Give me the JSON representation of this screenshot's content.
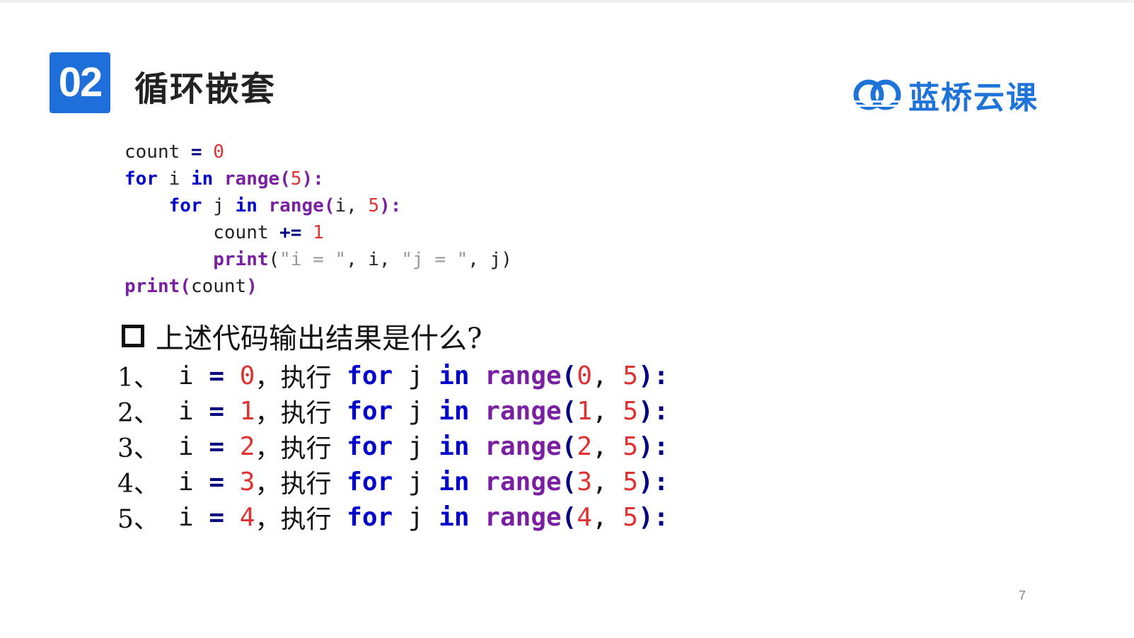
{
  "header": {
    "badge": "02",
    "title": "循环嵌套",
    "logo_text": "蓝桥云课",
    "brand_color": "#1e6fd9"
  },
  "code": {
    "line1": {
      "a": "count ",
      "op": "=",
      "num": "0"
    },
    "line2": {
      "kw1": "for",
      "a": " i ",
      "kw2": "in",
      "fn": "range",
      "p1": "(",
      "num": "5",
      "p2": "):"
    },
    "line3": {
      "indent": "    ",
      "kw1": "for",
      "a": " j ",
      "kw2": "in",
      "fn": "range",
      "p1": "(",
      "b": "i, ",
      "num": "5",
      "p2": "):"
    },
    "line4": {
      "indent": "        ",
      "a": "count ",
      "op": "+=",
      "num": "1"
    },
    "line5": {
      "indent": "        ",
      "fn": "print",
      "p1": "(",
      "s1": "\"i = \"",
      "b": ", i, ",
      "s2": "\"j = \"",
      "c": ", j)"
    },
    "line6": {
      "fn": "print",
      "p1": "(",
      "a": "count",
      "p2": ")"
    }
  },
  "question": "上述代码输出结果是什么?",
  "steps": [
    {
      "idx": "1、",
      "i": "i",
      "eq": "=",
      "val": "0",
      "sep": "，",
      "zh": "执行",
      "kw1": "for",
      "j": "j",
      "kw2": "in",
      "fn": "range",
      "open": "(",
      "start": "0",
      "comma": ",",
      "end": "5",
      "close": "):"
    },
    {
      "idx": "2、",
      "i": "i",
      "eq": "=",
      "val": "1",
      "sep": "，",
      "zh": "执行",
      "kw1": "for",
      "j": "j",
      "kw2": "in",
      "fn": "range",
      "open": "(",
      "start": "1",
      "comma": ",",
      "end": "5",
      "close": "):"
    },
    {
      "idx": "3、",
      "i": "i",
      "eq": "=",
      "val": "2",
      "sep": "，",
      "zh": "执行",
      "kw1": "for",
      "j": "j",
      "kw2": "in",
      "fn": "range",
      "open": "(",
      "start": "2",
      "comma": ",",
      "end": "5",
      "close": "):"
    },
    {
      "idx": "4、",
      "i": "i",
      "eq": "=",
      "val": "3",
      "sep": "，",
      "zh": "执行",
      "kw1": "for",
      "j": "j",
      "kw2": "in",
      "fn": "range",
      "open": "(",
      "start": "3",
      "comma": ",",
      "end": "5",
      "close": "):"
    },
    {
      "idx": "5、",
      "i": "i",
      "eq": "=",
      "val": "4",
      "sep": "，",
      "zh": "执行",
      "kw1": "for",
      "j": "j",
      "kw2": "in",
      "fn": "range",
      "open": "(",
      "start": "4",
      "comma": ",",
      "end": "5",
      "close": "):"
    }
  ],
  "page_number": "7"
}
